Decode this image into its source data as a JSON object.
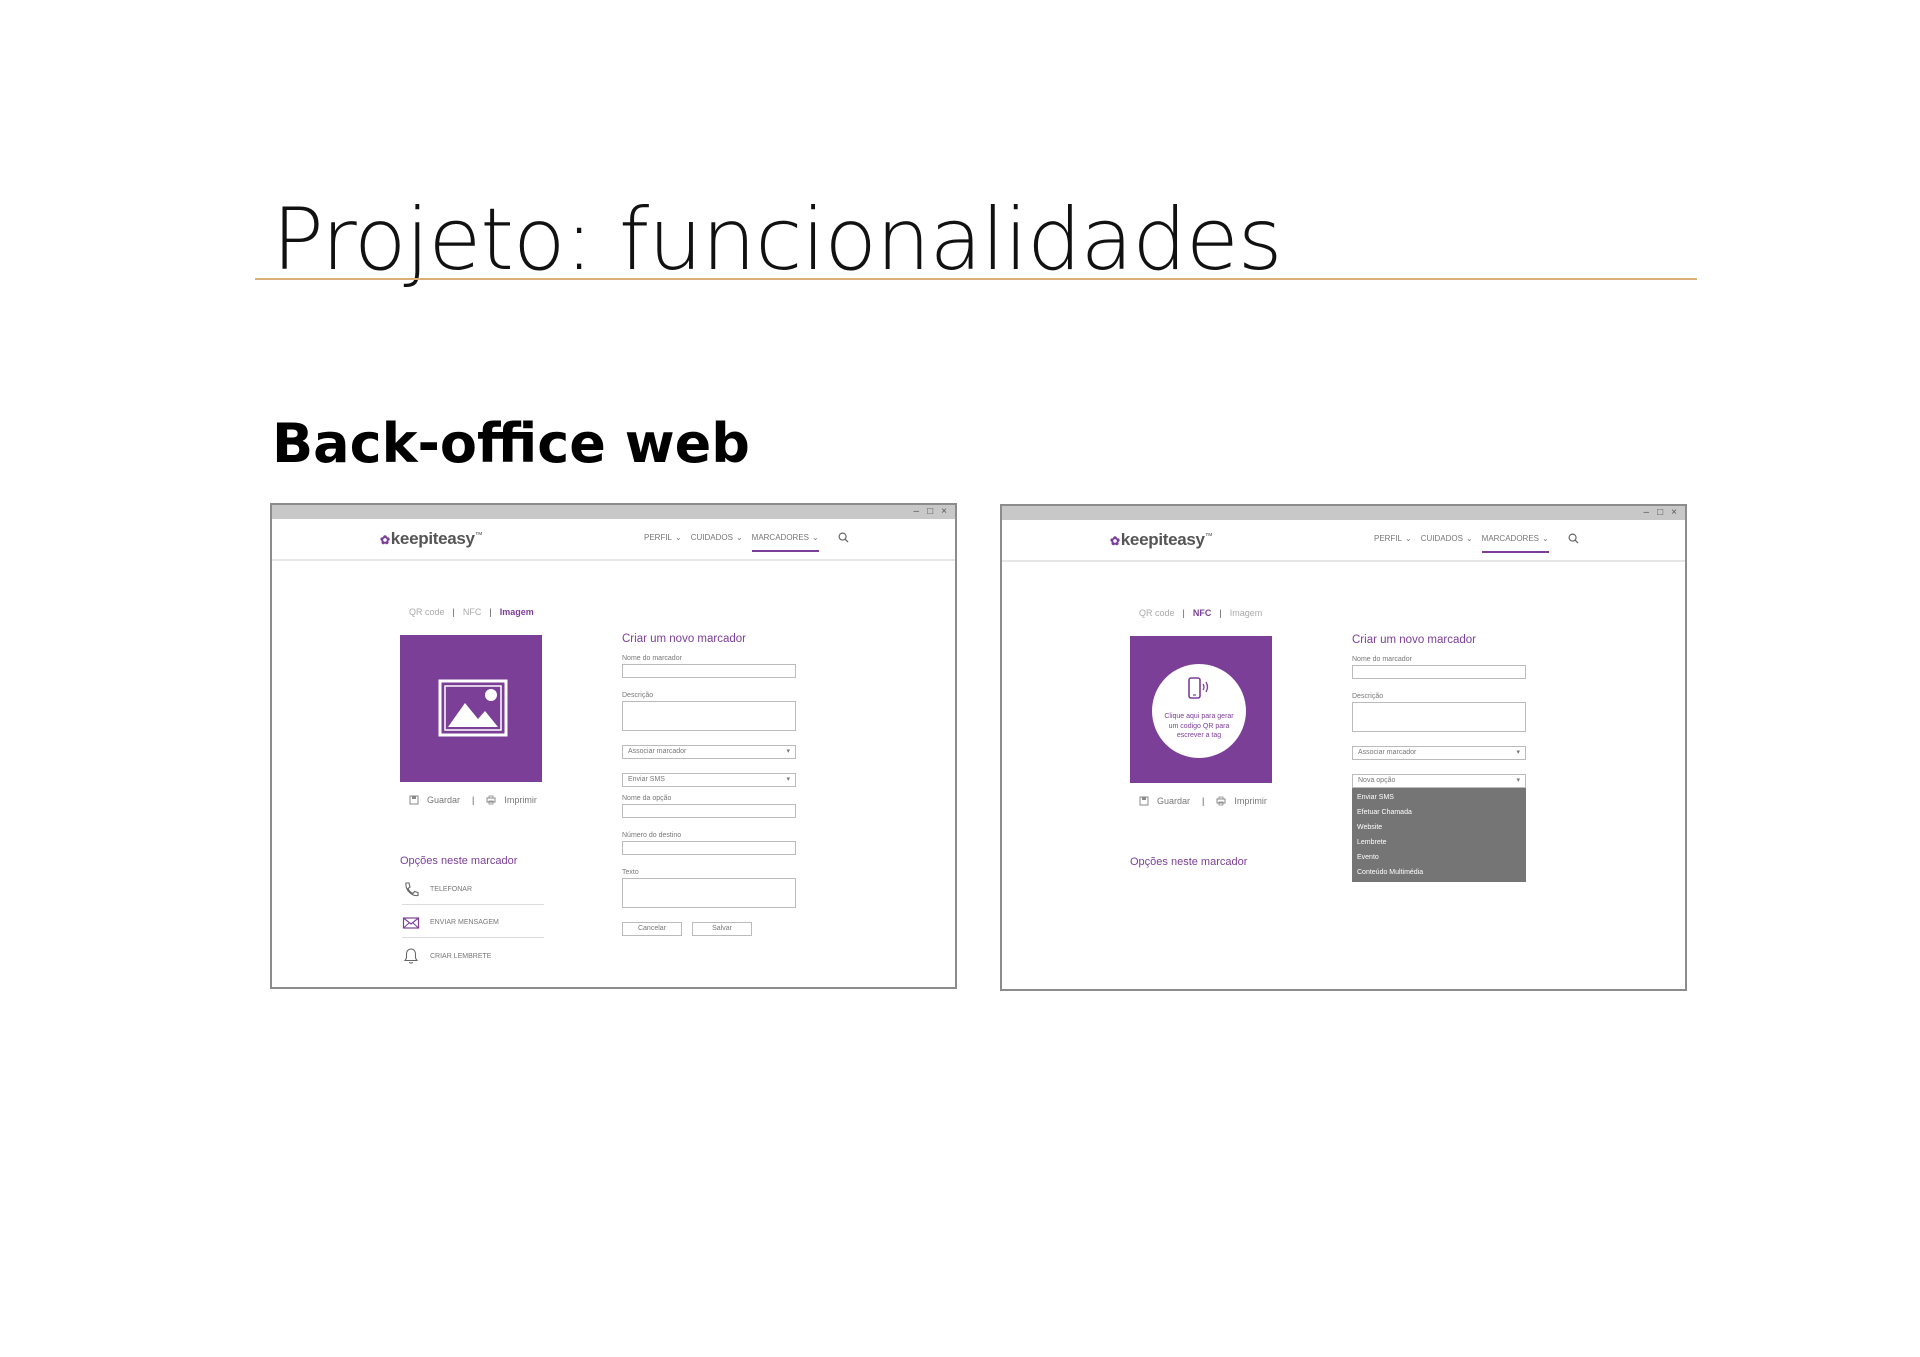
{
  "slide": {
    "title": "Projeto: funcionalidades",
    "subtitle": "Back-office web"
  },
  "colors": {
    "accent": "#7b3f98",
    "title_rule": "#d9b07a",
    "dropdown_bg": "#757575"
  },
  "app": {
    "logo": "keepiteasy",
    "logo_mark": "™",
    "nav": [
      {
        "label": "PERFIL"
      },
      {
        "label": "CUIDADOS"
      },
      {
        "label": "MARCADORES"
      }
    ],
    "tab_separator": "|"
  },
  "left_window": {
    "tabs": [
      "QR code",
      "NFC",
      "Imagem"
    ],
    "active_tab": "Imagem",
    "preview_icon": "image-icon",
    "actions": {
      "save": "Guardar",
      "print": "Imprimir"
    },
    "options_title": "Opções neste marcador",
    "options": [
      {
        "label": "TELEFONAR",
        "icon": "phone-icon"
      },
      {
        "label": "ENVIAR MENSAGEM",
        "icon": "mail-icon"
      },
      {
        "label": "CRIAR LEMBRETE",
        "icon": "bell-icon"
      }
    ],
    "form": {
      "title": "Criar um novo marcador",
      "name_label": "Nome do marcador",
      "description_label": "Descrição",
      "associate_select": "Associar marcador",
      "action_select": "Enviar SMS",
      "option_name_label": "Nome da opção",
      "destination_label": "Número do destino",
      "text_label": "Texto",
      "cancel": "Cancelar",
      "save": "Salvar"
    }
  },
  "right_window": {
    "tabs": [
      "QR code",
      "NFC",
      "Imagem"
    ],
    "active_tab": "NFC",
    "nfc_prompt": "Clique aqui para gerar um codigo QR para escrever a tag",
    "actions": {
      "save": "Guardar",
      "print": "Imprimir"
    },
    "options_title": "Opções neste marcador",
    "form": {
      "title": "Criar um novo marcador",
      "name_label": "Nome do marcador",
      "description_label": "Descrição",
      "associate_select": "Associar marcador",
      "new_option_select": "Nova opção",
      "dropdown_options": [
        "Enviar SMS",
        "Efetuar Chamada",
        "Website",
        "Lembrete",
        "Evento",
        "Conteúdo Multimédia"
      ]
    }
  }
}
